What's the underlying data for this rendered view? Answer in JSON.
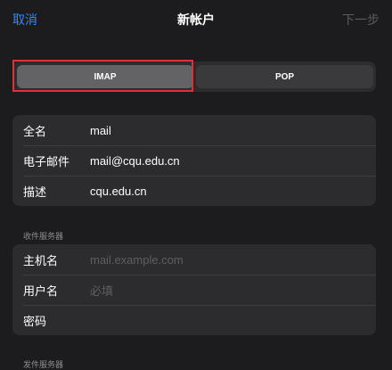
{
  "navbar": {
    "cancel_label": "取消",
    "title": "新帐户",
    "next_label": "下一步"
  },
  "segmented": {
    "options": [
      "IMAP",
      "POP"
    ],
    "selected": "IMAP"
  },
  "account_group": {
    "rows": [
      {
        "label": "全名",
        "value": "mail"
      },
      {
        "label": "电子邮件",
        "value": "mail@cqu.edu.cn"
      },
      {
        "label": "描述",
        "value": "cqu.edu.cn"
      }
    ]
  },
  "incoming_server": {
    "header": "收件服务器",
    "rows": [
      {
        "label": "主机名",
        "placeholder": "mail.example.com"
      },
      {
        "label": "用户名",
        "placeholder": "必填"
      },
      {
        "label": "密码",
        "placeholder": ""
      }
    ]
  },
  "outgoing_server": {
    "header": "发件服务器"
  },
  "colors": {
    "accent": "#2f88ff",
    "highlight": "#e0303a",
    "background": "#1c1c1e"
  }
}
